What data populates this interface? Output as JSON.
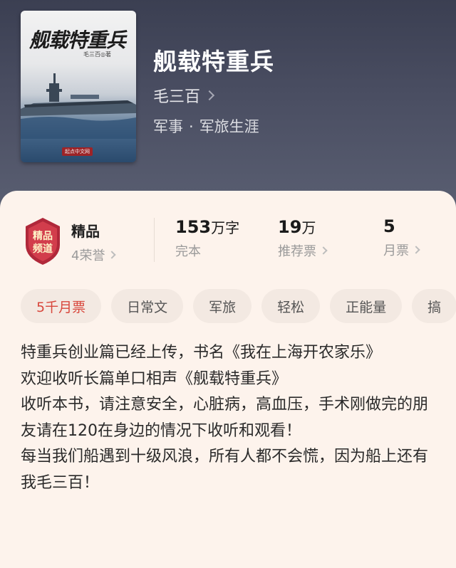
{
  "book": {
    "title": "舰载特重兵",
    "author": "毛三百",
    "genre_main": "军事",
    "genre_separator": "·",
    "genre_sub": "军旅生涯"
  },
  "cover": {
    "title": "舰载特重兵",
    "author_credit": "毛三百◎著",
    "publisher": "起点中文网"
  },
  "stats": {
    "quality_label": "精品",
    "honors": "4荣誉",
    "badge_text_line1": "精品",
    "badge_text_line2": "频道",
    "word_count_number": "153",
    "word_count_unit": "万字",
    "status": "完本",
    "recommend_number": "19",
    "recommend_unit": "万",
    "recommend_label": "推荐票",
    "monthly_number": "5",
    "monthly_label": "月票"
  },
  "tags": [
    "5千月票",
    "日常文",
    "军旅",
    "轻松",
    "正能量",
    "搞"
  ],
  "intro": [
    "特重兵创业篇已经上传，书名《我在上海开农家乐》",
    "欢迎收听长篇单口相声《舰载特重兵》",
    "收听本书，请注意安全，心脏病，高血压，手术刚做完的朋友请在120在身边的情况下收听和观看！",
    "每当我们船遇到十级风浪，所有人都不会慌，因为船上还有我毛三百！"
  ],
  "colors": {
    "header_bg": "#4a4e62",
    "card_bg": "#fdf3ec",
    "tag_bg": "#f3e9e2",
    "accent_red": "#d8473c"
  }
}
